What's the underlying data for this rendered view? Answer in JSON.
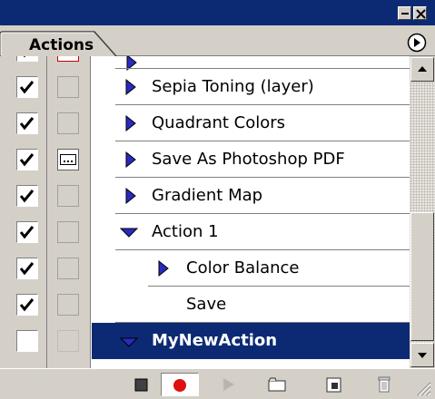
{
  "panel": {
    "tab_label": "Actions",
    "colors": {
      "title_bar": "#0c2a73",
      "panel_bg": "#d4d0c8",
      "selection": "#0c2a73",
      "triangle": "#2a2ac0",
      "record": "#e01010"
    }
  },
  "titlebar": {
    "buttons": [
      {
        "name": "minimize",
        "icon": "minimize-icon"
      },
      {
        "name": "close",
        "icon": "close-icon"
      }
    ]
  },
  "actions_list": {
    "items": [
      {
        "label": "",
        "checked": true,
        "dialog": "red",
        "expand": "collapsed",
        "level": 1,
        "partial": true
      },
      {
        "label": "Sepia Toning (layer)",
        "checked": true,
        "dialog": "none",
        "expand": "collapsed",
        "level": 1
      },
      {
        "label": "Quadrant Colors",
        "checked": true,
        "dialog": "none",
        "expand": "collapsed",
        "level": 1
      },
      {
        "label": "Save As Photoshop PDF",
        "checked": true,
        "dialog": "on",
        "expand": "collapsed",
        "level": 1
      },
      {
        "label": "Gradient Map",
        "checked": true,
        "dialog": "none",
        "expand": "collapsed",
        "level": 1
      },
      {
        "label": "Action 1",
        "checked": true,
        "dialog": "none",
        "expand": "expanded",
        "level": 1
      },
      {
        "label": "Color Balance",
        "checked": true,
        "dialog": "none",
        "expand": "collapsed",
        "level": 2
      },
      {
        "label": "Save",
        "checked": true,
        "dialog": "none",
        "expand": "none",
        "level": 2
      },
      {
        "label": "MyNewAction",
        "checked": false,
        "dialog": "none",
        "expand": "expanded",
        "level": 1,
        "selected": true
      }
    ]
  },
  "toolbar": {
    "buttons": [
      {
        "name": "stop",
        "icon": "stop-icon"
      },
      {
        "name": "record",
        "icon": "record-icon",
        "active": true
      },
      {
        "name": "play",
        "icon": "play-icon",
        "disabled": true
      },
      {
        "name": "new-set",
        "icon": "folder-icon"
      },
      {
        "name": "new-action",
        "icon": "new-action-icon"
      },
      {
        "name": "delete",
        "icon": "trash-icon"
      }
    ]
  }
}
